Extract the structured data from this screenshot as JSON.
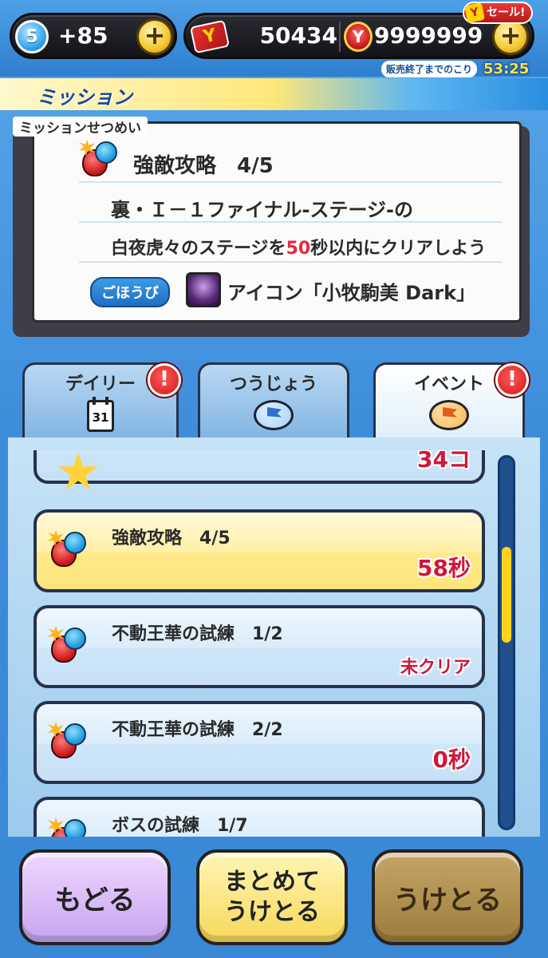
{
  "status_bar": {
    "stamina_level": "5",
    "stamina_value": "+85",
    "ticket_value": "50434",
    "coin_value": "9999999",
    "plus_label": "+",
    "sale_label": "セール!",
    "sale_timer_label": "販売終了までのこり",
    "sale_timer_value": "53:25"
  },
  "header": {
    "title": "ミッション"
  },
  "description": {
    "caption": "ミッションせつめい",
    "mission_title": "強敵攻略　4/5",
    "line1": "裏・Ｉ－１ファイナル-ステージ-の",
    "line2_prefix": "白夜虎々のステージを",
    "line2_highlight": "50",
    "line2_suffix": "秒以内にクリアしよう",
    "reward_label": "ごほうび",
    "reward_text": "アイコン「小牧駒美 Dark」"
  },
  "tabs": [
    {
      "label": "デイリー",
      "icon": "calendar-icon",
      "calendar_day": "31",
      "alert": "!"
    },
    {
      "label": "つうじょう",
      "icon": "blue-flag-bubble-icon"
    },
    {
      "label": "イベント",
      "icon": "orange-flag-bubble-icon",
      "alert": "!"
    }
  ],
  "missions": [
    {
      "title": "",
      "value": "34コ",
      "icon": "star-icon"
    },
    {
      "title": "強敵攻略　4/5",
      "value": "58秒",
      "highlighted": true
    },
    {
      "title": "不動王華の試練　1/2",
      "value": "未クリア"
    },
    {
      "title": "不動王華の試練　2/2",
      "value": "0秒"
    },
    {
      "title": "ボスの試練　1/7",
      "value": ""
    }
  ],
  "buttons": {
    "back": "もどる",
    "bulk_line1": "まとめて",
    "bulk_line2": "うけとる",
    "receive": "うけとる"
  },
  "colors": {
    "accent_red": "#d0163a",
    "highlight_yellow": "#ffe98a",
    "background_blue": "#3f93df"
  }
}
